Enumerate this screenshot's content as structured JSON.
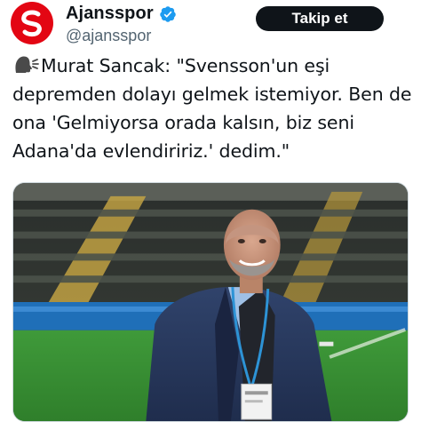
{
  "account": {
    "display_name": "Ajansspor",
    "handle": "@ajansspor",
    "verified": true,
    "brand_color": "#e30613"
  },
  "follow_button": {
    "label": "Takip et"
  },
  "tweet": {
    "icon": "speaking-head-icon",
    "text": "Murat Sancak:  \"Svensson'un eşi depremden dolayı gelmek istemiyor. Ben de ona 'Gelmiyorsa orada kalsın, biz seni Adana'da evlendiririz.' dedim.\""
  },
  "media": {
    "description_icon": "photo"
  },
  "colors": {
    "text": "#0f1419",
    "secondary": "#536471",
    "verified": "#1d9bf0",
    "button_bg": "#0f1419"
  }
}
